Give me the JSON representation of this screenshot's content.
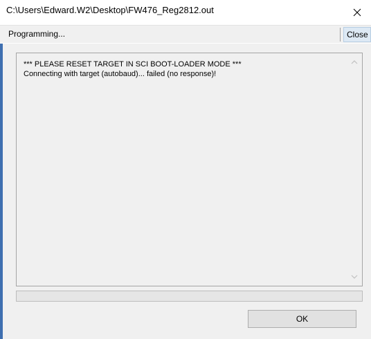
{
  "window": {
    "title": "C:\\Users\\Edward.W2\\Desktop\\FW476_Reg2812.out",
    "close_icon": "close-icon"
  },
  "toolbar": {
    "status": "Programming...",
    "close_label": "Close"
  },
  "log": {
    "lines": [
      "*** PLEASE RESET TARGET IN SCI BOOT-LOADER MODE ***",
      "Connecting with target (autobaud)... failed (no response)!"
    ],
    "scroll_up_icon": "chevron-up-icon",
    "scroll_down_icon": "chevron-down-icon"
  },
  "progress": {
    "value": 0
  },
  "footer": {
    "ok_label": "OK"
  },
  "colors": {
    "accent_border": "#3f6fb0",
    "close_button_bg": "#dde9f4"
  }
}
